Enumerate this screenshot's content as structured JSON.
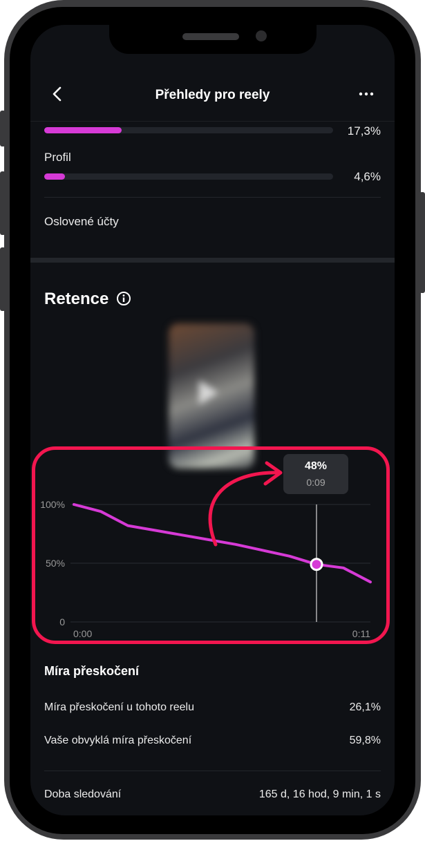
{
  "header": {
    "title": "Přehledy pro reely"
  },
  "reach_rows": [
    {
      "label": "",
      "percent": "17,3%",
      "fill_fraction": 0.173
    },
    {
      "label": "Profil",
      "percent": "4,6%",
      "fill_fraction": 0.046
    }
  ],
  "reached_accounts": {
    "label": "Oslovené účty"
  },
  "retention": {
    "title": "Retence",
    "tooltip": {
      "value": "48%",
      "time": "0:09"
    }
  },
  "chart_data": {
    "type": "line",
    "title": "",
    "xlabel": "",
    "ylabel": "",
    "x_tick_labels": [
      "0:00",
      "0:11"
    ],
    "y_tick_labels": [
      "100%",
      "50%",
      "0"
    ],
    "xlim": [
      0,
      11
    ],
    "ylim": [
      0,
      100
    ],
    "grid": true,
    "series": [
      {
        "color": "#d63ad6",
        "x": [
          0,
          1,
          2,
          3,
          4,
          5,
          6,
          7,
          8,
          9,
          10,
          11
        ],
        "y": [
          100,
          94,
          82,
          78,
          74,
          70,
          66,
          61,
          56,
          49,
          46,
          34
        ]
      }
    ],
    "highlight_point": {
      "x": 9,
      "y": 49
    },
    "annotation_color": "#f2164f"
  },
  "skip_rate": {
    "title": "Míra přeskočení",
    "rows": [
      {
        "label": "Míra přeskočení u tohoto reelu",
        "value": "26,1%"
      },
      {
        "label": "Vaše obvyklá míra přeskočení",
        "value": "59,8%"
      }
    ]
  },
  "watch_time": {
    "label": "Doba sledování",
    "value": "165 d, 16 hod, 9 min, 1 s"
  },
  "colors": {
    "accent": "#d63ad6",
    "background": "#0f1115",
    "highlight": "#f2164f"
  }
}
